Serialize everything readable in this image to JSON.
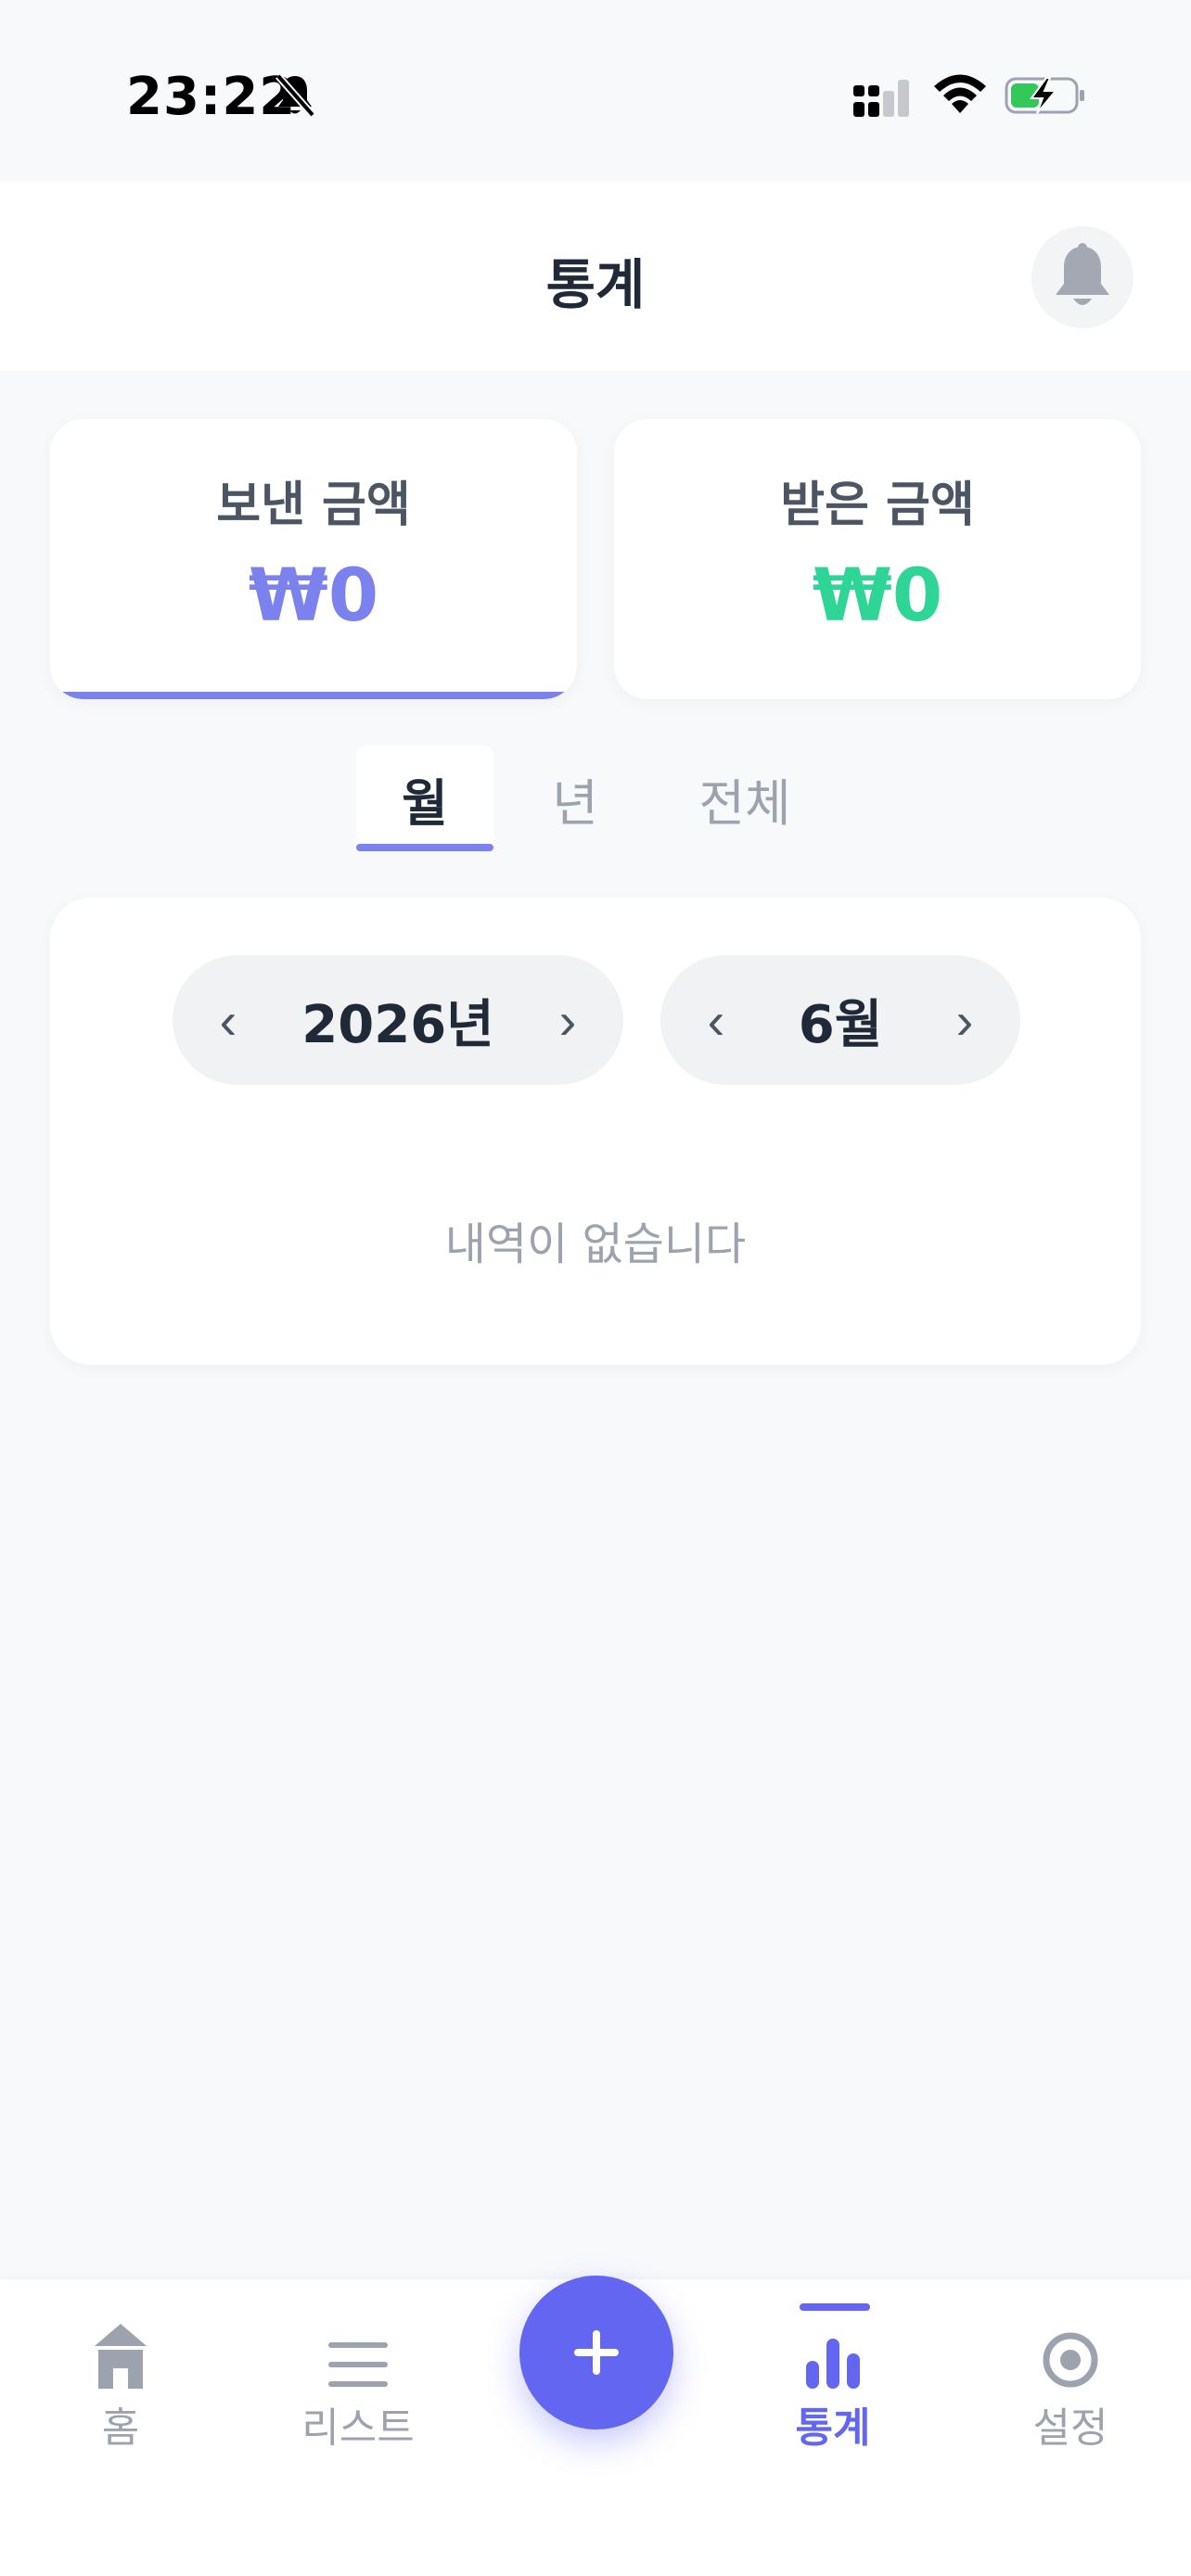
{
  "status_bar": {
    "time": "23:22"
  },
  "header": {
    "title": "통계"
  },
  "summary": {
    "sent": {
      "label": "보낸 금액",
      "value": "₩0"
    },
    "received": {
      "label": "받은 금액",
      "value": "₩0"
    }
  },
  "period_tabs": {
    "items": [
      {
        "label": "월",
        "active": true
      },
      {
        "label": "년",
        "active": false
      },
      {
        "label": "전체",
        "active": false
      }
    ]
  },
  "selector": {
    "year": {
      "value": "2026년",
      "prev": "‹",
      "next": "›"
    },
    "month": {
      "value": "6월",
      "prev": "‹",
      "next": "›"
    },
    "empty_message": "내역이 없습니다"
  },
  "bottom_nav": {
    "items": [
      {
        "label": "홈",
        "icon": "home-icon",
        "active": false
      },
      {
        "label": "리스트",
        "icon": "list-icon",
        "active": false
      },
      {
        "label": "통계",
        "icon": "bar-chart-icon",
        "active": true
      },
      {
        "label": "설정",
        "icon": "settings-icon",
        "active": false
      }
    ],
    "fab": {
      "label": "+"
    }
  },
  "colors": {
    "accent": "#6366f1",
    "sent_amount": "#7b82ee",
    "received_amount": "#2fd597",
    "muted_text": "#9ca3af"
  }
}
